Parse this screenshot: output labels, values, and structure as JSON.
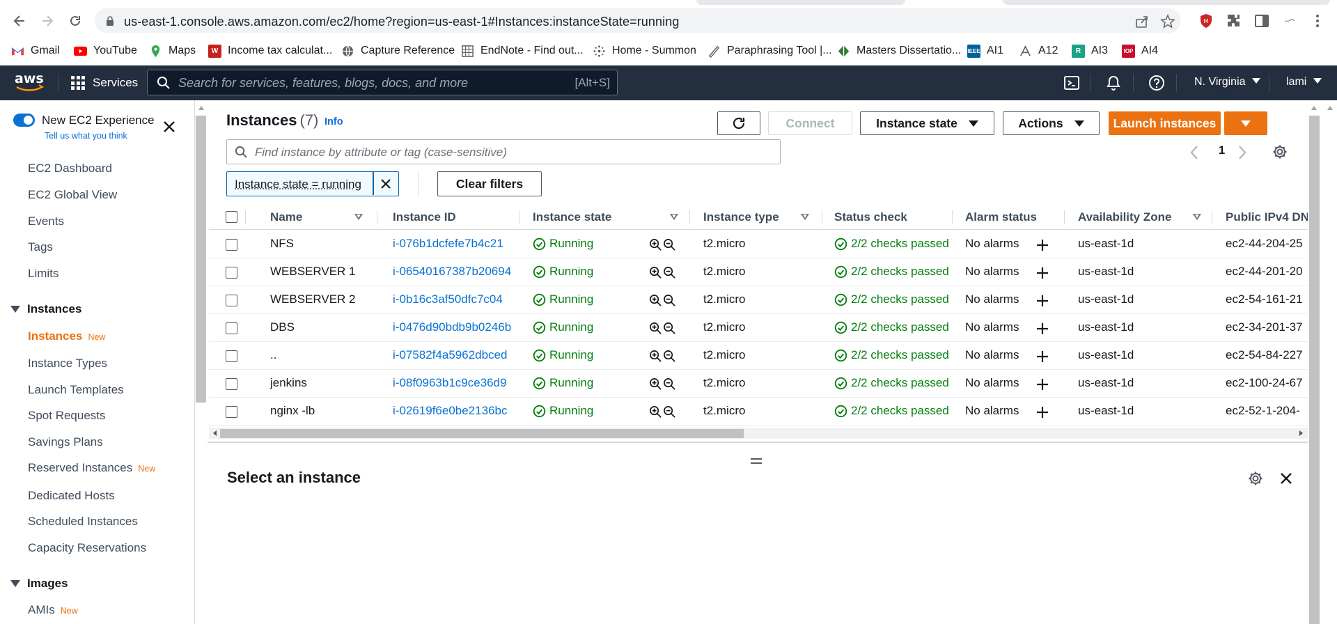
{
  "browser": {
    "url": "us-east-1.console.aws.amazon.com/ec2/home?region=us-east-1#Instances:instanceState=running",
    "bookmarks": [
      {
        "label": "Gmail",
        "icon": "gmail-icon",
        "color": "#ea4335"
      },
      {
        "label": "YouTube",
        "icon": "youtube-icon",
        "color": "#ff0000"
      },
      {
        "label": "Maps",
        "icon": "maps-icon",
        "color": "#34a853"
      },
      {
        "label": "Income tax calculat...",
        "icon": "income-tax-icon",
        "color": "#c5221f"
      },
      {
        "label": "Capture Reference",
        "icon": "globe-icon",
        "color": "#5f6368"
      },
      {
        "label": "EndNote - Find out...",
        "icon": "endnote-icon",
        "color": "#5f6368"
      },
      {
        "label": "Home - Summon",
        "icon": "summon-icon",
        "color": "#5f6368"
      },
      {
        "label": "Paraphrasing Tool |...",
        "icon": "quill-icon",
        "color": "#5f6368"
      },
      {
        "label": "Masters Dissertatio...",
        "icon": "dissertation-icon",
        "color": "#5f6368"
      },
      {
        "label": "AI1",
        "icon": "ieee-icon",
        "color": "#00629b"
      },
      {
        "label": "A12",
        "icon": "a12-icon",
        "color": "#5f6368"
      },
      {
        "label": "AI3",
        "icon": "r-icon",
        "color": "#1aa384"
      },
      {
        "label": "AI4",
        "icon": "iop-icon",
        "color": "#c8102e"
      }
    ]
  },
  "aws_nav": {
    "logo": "aws",
    "services_label": "Services",
    "search_placeholder": "Search for services, features, blogs, docs, and more",
    "search_shortcut": "[Alt+S]",
    "region": "N. Virginia",
    "user": "lami"
  },
  "sidebar": {
    "new_experience_title": "New EC2 Experience",
    "new_experience_sub": "Tell us what you think",
    "items_top": [
      "EC2 Dashboard",
      "EC2 Global View",
      "Events",
      "Tags",
      "Limits"
    ],
    "section_instances": "Instances",
    "instances_items": [
      {
        "label": "Instances",
        "badge": "New"
      },
      {
        "label": "Instance Types",
        "badge": ""
      },
      {
        "label": "Launch Templates",
        "badge": ""
      },
      {
        "label": "Spot Requests",
        "badge": ""
      },
      {
        "label": "Savings Plans",
        "badge": ""
      },
      {
        "label": "Reserved Instances",
        "badge": "New"
      },
      {
        "label": "Dedicated Hosts",
        "badge": ""
      },
      {
        "label": "Scheduled Instances",
        "badge": ""
      },
      {
        "label": "Capacity Reservations",
        "badge": ""
      }
    ],
    "section_images": "Images",
    "images_items": [
      {
        "label": "AMIs",
        "badge": "New"
      }
    ]
  },
  "main": {
    "title": "Instances",
    "count": "(7)",
    "info": "Info",
    "connect": "Connect",
    "instance_state": "Instance state",
    "actions": "Actions",
    "launch": "Launch instances",
    "filter_placeholder": "Find instance by attribute or tag (case-sensitive)",
    "page": "1",
    "token": "Instance state = running",
    "clear_filters": "Clear filters",
    "columns": [
      "Name",
      "Instance ID",
      "Instance state",
      "Instance type",
      "Status check",
      "Alarm status",
      "Availability Zone",
      "Public IPv4 DN"
    ],
    "rows": [
      {
        "name": "NFS",
        "id": "i-076b1dcfefe7b4c21",
        "state": "Running",
        "type": "t2.micro",
        "status": "2/2 checks passed",
        "alarm": "No alarms",
        "az": "us-east-1d",
        "dns": "ec2-44-204-25"
      },
      {
        "name": "WEBSERVER 1",
        "id": "i-06540167387b20694",
        "state": "Running",
        "type": "t2.micro",
        "status": "2/2 checks passed",
        "alarm": "No alarms",
        "az": "us-east-1d",
        "dns": "ec2-44-201-20"
      },
      {
        "name": "WEBSERVER 2",
        "id": "i-0b16c3af50dfc7c04",
        "state": "Running",
        "type": "t2.micro",
        "status": "2/2 checks passed",
        "alarm": "No alarms",
        "az": "us-east-1d",
        "dns": "ec2-54-161-21"
      },
      {
        "name": "DBS",
        "id": "i-0476d90bdb9b0246b",
        "state": "Running",
        "type": "t2.micro",
        "status": "2/2 checks passed",
        "alarm": "No alarms",
        "az": "us-east-1d",
        "dns": "ec2-34-201-37"
      },
      {
        "name": "..",
        "id": "i-07582f4a5962dbced",
        "state": "Running",
        "type": "t2.micro",
        "status": "2/2 checks passed",
        "alarm": "No alarms",
        "az": "us-east-1d",
        "dns": "ec2-54-84-227"
      },
      {
        "name": "jenkins",
        "id": "i-08f0963b1c9ce36d9",
        "state": "Running",
        "type": "t2.micro",
        "status": "2/2 checks passed",
        "alarm": "No alarms",
        "az": "us-east-1d",
        "dns": "ec2-100-24-67"
      },
      {
        "name": "nginx -lb",
        "id": "i-02619f6e0be2136bc",
        "state": "Running",
        "type": "t2.micro",
        "status": "2/2 checks passed",
        "alarm": "No alarms",
        "az": "us-east-1d",
        "dns": "ec2-52-1-204-"
      }
    ],
    "detail_title": "Select an instance"
  },
  "colors": {
    "aws_nav": "#232f3e",
    "accent_orange": "#ec7211",
    "link_blue": "#0972d3",
    "success_green": "#037f0c"
  }
}
